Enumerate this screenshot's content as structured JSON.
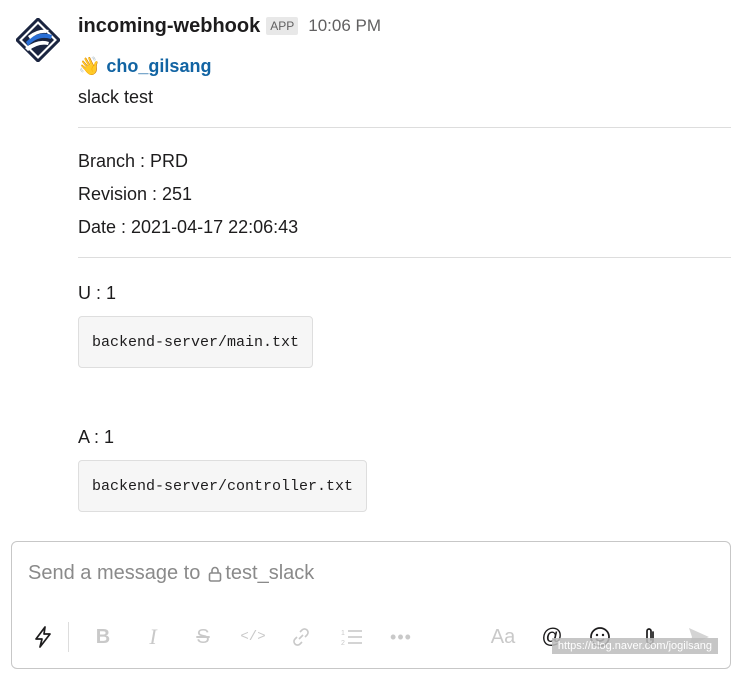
{
  "message": {
    "sender": "incoming-webhook",
    "badge": "APP",
    "time": "10:06 PM",
    "mention_emoji": "👋",
    "mention": "cho_gilsang",
    "text": "slack test",
    "branch": "Branch : PRD",
    "revision": "Revision : 251",
    "date": "Date : 2021-04-17 22:06:43",
    "updated_label": "U : 1",
    "updated_file": "backend-server/main.txt",
    "added_label": "A : 1",
    "added_file": "backend-server/controller.txt"
  },
  "composer": {
    "placeholder_prefix": "Send a message to",
    "channel": "test_slack",
    "format_label": "Aa"
  },
  "watermark": "https://blog.naver.com/jogilsang",
  "icons": [
    "app-avatar-icon",
    "lightning-icon",
    "bold-icon",
    "italic-icon",
    "strikethrough-icon",
    "code-icon",
    "link-icon",
    "numbered-list-icon",
    "more-icon",
    "format-icon",
    "mention-icon",
    "emoji-icon",
    "attachment-icon",
    "send-icon",
    "lock-icon"
  ],
  "colors": {
    "link": "#1264a3",
    "text": "#1d1c1d",
    "muted": "#616061",
    "avatar_blue": "#2a6fd6",
    "avatar_dark": "#1b2540"
  }
}
